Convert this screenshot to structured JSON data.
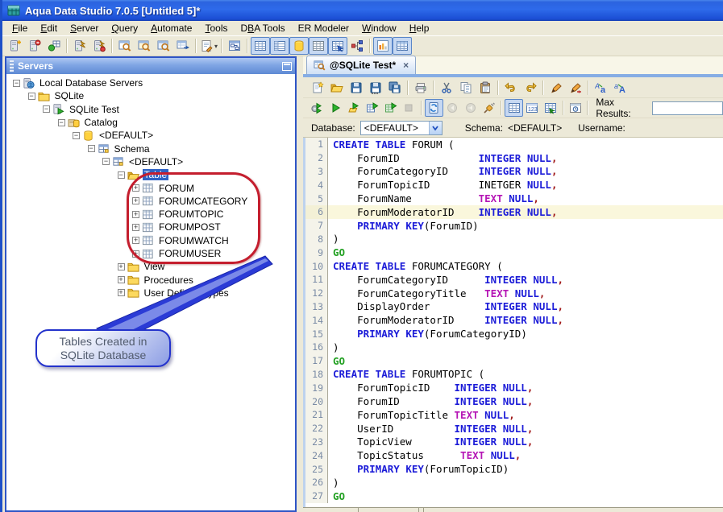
{
  "window": {
    "title": "Aqua Data Studio 7.0.5 [Untitled 5]*"
  },
  "menu": {
    "items": [
      {
        "label": "File",
        "accel": 0
      },
      {
        "label": "Edit",
        "accel": 0
      },
      {
        "label": "Server",
        "accel": 0
      },
      {
        "label": "Query",
        "accel": 0
      },
      {
        "label": "Automate",
        "accel": 0
      },
      {
        "label": "Tools",
        "accel": 0
      },
      {
        "label": "DBA Tools",
        "accel": 1
      },
      {
        "label": "ER Modeler",
        "accel": -1
      },
      {
        "label": "Window",
        "accel": 0
      },
      {
        "label": "Help",
        "accel": 0
      }
    ]
  },
  "main_toolbar": {
    "buttons": [
      {
        "icon": "server-plus"
      },
      {
        "icon": "server-del"
      },
      {
        "icon": "connections"
      },
      {
        "sep": true
      },
      {
        "icon": "server-connect"
      },
      {
        "icon": "server-disconnect"
      },
      {
        "sep": true
      },
      {
        "icon": "query-window"
      },
      {
        "icon": "query-window2"
      },
      {
        "icon": "query-window3"
      },
      {
        "icon": "table-window"
      },
      {
        "sep": true
      },
      {
        "icon": "script",
        "dropdown": true
      },
      {
        "sep": true
      },
      {
        "icon": "er-window"
      },
      {
        "sep": true
      },
      {
        "icon": "grid-table",
        "toggled": true
      },
      {
        "icon": "grid-form",
        "toggled": true
      },
      {
        "icon": "db-cylinder",
        "toggled": true
      },
      {
        "icon": "grid-plain",
        "toggled": true
      },
      {
        "icon": "grid-arrow",
        "toggled": true
      },
      {
        "icon": "hierarchy"
      },
      {
        "sep": true
      },
      {
        "icon": "chart-bars",
        "toggled": true
      },
      {
        "icon": "grid-blue",
        "toggled": true
      }
    ]
  },
  "servers_panel": {
    "title": "Servers",
    "tree": [
      {
        "label": "Local Database Servers",
        "depth": 0,
        "icon": "server-globe",
        "expander": "minus"
      },
      {
        "label": "SQLite",
        "depth": 1,
        "icon": "folder",
        "expander": "minus"
      },
      {
        "label": "SQLite Test",
        "depth": 2,
        "icon": "server-play",
        "expander": "minus"
      },
      {
        "label": "Catalog",
        "depth": 3,
        "icon": "catalog",
        "expander": "minus"
      },
      {
        "label": "<DEFAULT>",
        "depth": 4,
        "icon": "db-cylinder",
        "expander": "minus"
      },
      {
        "label": "Schema",
        "depth": 5,
        "icon": "schema-grid",
        "expander": "minus"
      },
      {
        "label": "<DEFAULT>",
        "depth": 6,
        "icon": "schema-grid",
        "expander": "minus"
      },
      {
        "label": "Table",
        "depth": 7,
        "icon": "folder-open",
        "expander": "minus",
        "selected": true
      },
      {
        "label": "FORUM",
        "depth": 8,
        "icon": "table",
        "expander": "plus"
      },
      {
        "label": "FORUMCATEGORY",
        "depth": 8,
        "icon": "table",
        "expander": "plus"
      },
      {
        "label": "FORUMTOPIC",
        "depth": 8,
        "icon": "table",
        "expander": "plus"
      },
      {
        "label": "FORUMPOST",
        "depth": 8,
        "icon": "table",
        "expander": "plus"
      },
      {
        "label": "FORUMWATCH",
        "depth": 8,
        "icon": "table",
        "expander": "plus"
      },
      {
        "label": "FORUMUSER",
        "depth": 8,
        "icon": "table",
        "expander": "plus"
      },
      {
        "label": "View",
        "depth": 7,
        "icon": "folder",
        "expander": "plus"
      },
      {
        "label": "Procedures",
        "depth": 7,
        "icon": "folder",
        "expander": "plus"
      },
      {
        "label": "User Defined Types",
        "depth": 7,
        "icon": "folder",
        "expander": "plus"
      }
    ]
  },
  "annotation": {
    "line1": "Tables Created in",
    "line2": "SQLite Database"
  },
  "editor": {
    "tab": {
      "label": "@SQLite Test*",
      "close": "×"
    },
    "toolbar_file": {
      "buttons": [
        {
          "icon": "new-file"
        },
        {
          "icon": "open-folder"
        },
        {
          "icon": "save"
        },
        {
          "icon": "save-as"
        },
        {
          "icon": "save-all"
        },
        {
          "sep": true
        },
        {
          "icon": "print"
        },
        {
          "sep": true
        },
        {
          "icon": "cut"
        },
        {
          "icon": "copy"
        },
        {
          "icon": "paste"
        },
        {
          "sep": true
        },
        {
          "icon": "undo"
        },
        {
          "icon": "redo"
        },
        {
          "sep": true
        },
        {
          "icon": "format-pen"
        },
        {
          "icon": "format-pen-arrow"
        },
        {
          "sep": true
        },
        {
          "icon": "case-lower"
        },
        {
          "icon": "case-upper"
        }
      ]
    },
    "toolbar_exec": {
      "buttons": [
        {
          "icon": "exec-gear"
        },
        {
          "icon": "exec-play"
        },
        {
          "icon": "exec-open"
        },
        {
          "icon": "exec-edit"
        },
        {
          "icon": "exec-grid"
        },
        {
          "icon": "stop",
          "disabled": true
        },
        {
          "sep": true
        },
        {
          "icon": "auto-commit",
          "toggled": true
        },
        {
          "icon": "commit",
          "disabled": true
        },
        {
          "icon": "rollback",
          "disabled": true
        },
        {
          "icon": "plug"
        },
        {
          "sep": true
        },
        {
          "icon": "result-grid",
          "toggled": true
        },
        {
          "icon": "result-text"
        },
        {
          "icon": "result-export"
        },
        {
          "sep": true
        },
        {
          "icon": "history"
        },
        {
          "sep": true
        }
      ],
      "max_results_label": "Max Results:",
      "max_results_value": ""
    },
    "context": {
      "database_label": "Database:",
      "database_value": "<DEFAULT>",
      "schema_label": "Schema:",
      "schema_value": "<DEFAULT>",
      "username_label": "Username:",
      "username_value": ""
    },
    "code": {
      "current_line": 6,
      "lines": [
        {
          "n": 1,
          "tokens": [
            [
              "k",
              "CREATE TABLE"
            ],
            [
              "t",
              " FORUM ("
            ]
          ]
        },
        {
          "n": 2,
          "tokens": [
            [
              "t",
              "    ForumID             "
            ],
            [
              "k",
              "INTEGER NULL"
            ],
            [
              "c",
              ","
            ]
          ]
        },
        {
          "n": 3,
          "tokens": [
            [
              "t",
              "    ForumCategoryID     "
            ],
            [
              "k",
              "INTEGER NULL"
            ],
            [
              "c",
              ","
            ]
          ]
        },
        {
          "n": 4,
          "tokens": [
            [
              "t",
              "    ForumTopicID        INETGER "
            ],
            [
              "k",
              "NULL"
            ],
            [
              "c",
              ","
            ]
          ]
        },
        {
          "n": 5,
          "tokens": [
            [
              "t",
              "    ForumName           "
            ],
            [
              "d",
              "TEXT"
            ],
            [
              "t",
              " "
            ],
            [
              "k",
              "NULL"
            ],
            [
              "c",
              ","
            ]
          ]
        },
        {
          "n": 6,
          "tokens": [
            [
              "t",
              "    ForumModeratorID    "
            ],
            [
              "k",
              "INTEGER NULL"
            ],
            [
              "c",
              ","
            ]
          ]
        },
        {
          "n": 7,
          "tokens": [
            [
              "t",
              "    "
            ],
            [
              "k",
              "PRIMARY KEY"
            ],
            [
              "t",
              "(ForumID)"
            ]
          ]
        },
        {
          "n": 8,
          "tokens": [
            [
              "t",
              ")"
            ]
          ]
        },
        {
          "n": 9,
          "tokens": [
            [
              "g",
              "GO"
            ]
          ]
        },
        {
          "n": 10,
          "tokens": [
            [
              "k",
              "CREATE TABLE"
            ],
            [
              "t",
              " FORUMCATEGORY ("
            ]
          ]
        },
        {
          "n": 11,
          "tokens": [
            [
              "t",
              "    ForumCategoryID      "
            ],
            [
              "k",
              "INTEGER NULL"
            ],
            [
              "c",
              ","
            ]
          ]
        },
        {
          "n": 12,
          "tokens": [
            [
              "t",
              "    ForumCategoryTitle   "
            ],
            [
              "d",
              "TEXT"
            ],
            [
              "t",
              " "
            ],
            [
              "k",
              "NULL"
            ],
            [
              "c",
              ","
            ]
          ]
        },
        {
          "n": 13,
          "tokens": [
            [
              "t",
              "    DisplayOrder         "
            ],
            [
              "k",
              "INTEGER NULL"
            ],
            [
              "c",
              ","
            ]
          ]
        },
        {
          "n": 14,
          "tokens": [
            [
              "t",
              "    ForumModeratorID     "
            ],
            [
              "k",
              "INTEGER NULL"
            ],
            [
              "c",
              ","
            ]
          ]
        },
        {
          "n": 15,
          "tokens": [
            [
              "t",
              "    "
            ],
            [
              "k",
              "PRIMARY KEY"
            ],
            [
              "t",
              "(ForumCategoryID)"
            ]
          ]
        },
        {
          "n": 16,
          "tokens": [
            [
              "t",
              ")"
            ]
          ]
        },
        {
          "n": 17,
          "tokens": [
            [
              "g",
              "GO"
            ]
          ]
        },
        {
          "n": 18,
          "tokens": [
            [
              "k",
              "CREATE TABLE"
            ],
            [
              "t",
              " FORUMTOPIC ("
            ]
          ]
        },
        {
          "n": 19,
          "tokens": [
            [
              "t",
              "    ForumTopicID    "
            ],
            [
              "k",
              "INTEGER NULL"
            ],
            [
              "c",
              ","
            ]
          ]
        },
        {
          "n": 20,
          "tokens": [
            [
              "t",
              "    ForumID         "
            ],
            [
              "k",
              "INTEGER NULL"
            ],
            [
              "c",
              ","
            ]
          ]
        },
        {
          "n": 21,
          "tokens": [
            [
              "t",
              "    ForumTopicTitle "
            ],
            [
              "d",
              "TEXT"
            ],
            [
              "t",
              " "
            ],
            [
              "k",
              "NULL"
            ],
            [
              "c",
              ","
            ]
          ]
        },
        {
          "n": 22,
          "tokens": [
            [
              "t",
              "    UserID          "
            ],
            [
              "k",
              "INTEGER NULL"
            ],
            [
              "c",
              ","
            ]
          ]
        },
        {
          "n": 23,
          "tokens": [
            [
              "t",
              "    TopicView       "
            ],
            [
              "k",
              "INTEGER NULL"
            ],
            [
              "c",
              ","
            ]
          ]
        },
        {
          "n": 24,
          "tokens": [
            [
              "t",
              "    TopicStatus      "
            ],
            [
              "d",
              "TEXT"
            ],
            [
              "t",
              " "
            ],
            [
              "k",
              "NULL"
            ],
            [
              "c",
              ","
            ]
          ]
        },
        {
          "n": 25,
          "tokens": [
            [
              "t",
              "    "
            ],
            [
              "k",
              "PRIMARY KEY"
            ],
            [
              "t",
              "(ForumTopicID)"
            ]
          ]
        },
        {
          "n": 26,
          "tokens": [
            [
              "t",
              ")"
            ]
          ]
        },
        {
          "n": 27,
          "tokens": [
            [
              "g",
              "GO"
            ]
          ]
        }
      ]
    }
  },
  "colors": {
    "keyword": "#1C1CD8",
    "datatype": "#B515B5",
    "go": "#22A022",
    "comma": "#A01818",
    "selection": "#2F63C4",
    "current_line": "#FAF7DC",
    "annotation_red": "#C41E2E",
    "annotation_blue": "#2433CC"
  }
}
